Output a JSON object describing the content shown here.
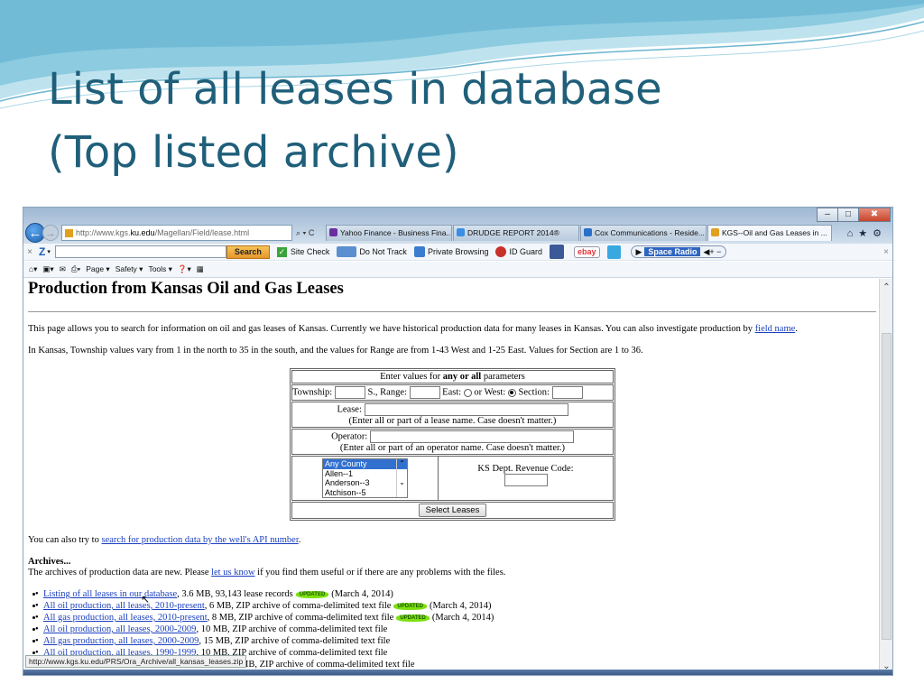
{
  "slide": {
    "title_line1": "List of all leases in database",
    "title_line2": "(Top listed archive)"
  },
  "browser": {
    "address": {
      "prefix": "http://www.kgs.",
      "host": "ku.edu",
      "path": "/Magellan/Field/lease.html"
    },
    "address_icons": "⌕ ▾ C",
    "tabs": [
      {
        "label": "Yahoo Finance - Business Fina...",
        "icon_color": "#6b2fa0"
      },
      {
        "label": "DRUDGE REPORT 2014®",
        "icon_color": "#3a8ee6"
      },
      {
        "label": "Cox Communications - Reside...",
        "icon_color": "#2a6fc9"
      },
      {
        "label": "KGS--Oil and Gas Leases in ...",
        "icon_color": "#e0a020",
        "active": true
      }
    ],
    "active_tab_close": "×",
    "right_icons": "⌂★⚙",
    "win_controls": [
      "–",
      "□",
      "✖"
    ],
    "toolbar1": {
      "logo": "Z",
      "search_button": "Search",
      "site_check": "Site Check",
      "do_not_track": "Do Not Track",
      "private_browsing": "Private Browsing",
      "id_guard": "ID Guard",
      "ebay": "ebay",
      "radio_label": "Space Radio",
      "volume": "◀+ −",
      "close": "×"
    },
    "toolbar2": {
      "page": "Page ▾",
      "safety": "Safety ▾",
      "tools": "Tools ▾",
      "help": "❓▾"
    },
    "status_url": "http://www.kgs.ku.edu/PRS/Ora_Archive/all_kansas_leases.zip"
  },
  "page": {
    "heading": "Production from Kansas Oil and Gas Leases",
    "intro": "This page allows you to search for information on oil and gas leases of Kansas. Currently we have historical production data for many leases in Kansas. You can also investigate production by ",
    "intro_link": "field name",
    "intro_end": ".",
    "township_info": "In Kansas, Township values vary from 1 in the north to 35 in the south, and the values for Range are from 1-43 West and 1-25 East. Values for Section are 1 to 36.",
    "form": {
      "header_pre": "Enter values for ",
      "header_bold": "any or all",
      "header_post": " parameters",
      "township_label": "Township:",
      "s_range_label": "S., Range:",
      "east_label": "East:",
      "west_label": "or West:",
      "section_label": "Section:",
      "lease_label": "Lease:",
      "lease_hint": "(Enter all or part of a lease name. Case doesn't matter.)",
      "operator_label": "Operator:",
      "operator_hint": "(Enter all or part of an operator name. Case doesn't matter.)",
      "county_options": [
        "Any County",
        "Allen--1",
        "Anderson--3",
        "Atchison--5"
      ],
      "ks_code_label": "KS Dept. Revenue Code:",
      "submit": "Select Leases"
    },
    "api_pre": "You can also try to ",
    "api_link": "search for production data by the well's API number",
    "api_post": ".",
    "archives_heading": "Archives...",
    "archives_pre": "The archives of production data are new. Please ",
    "archives_link": "let us know",
    "archives_post": " if you find them useful or if there are any problems with the files.",
    "badge_text": "UPDATED",
    "archive_items": [
      {
        "link": "Listing of all leases in our database",
        "text": ", 3.6 MB, 93,143 lease records",
        "date": "(March 4, 2014)"
      },
      {
        "link": "All oil production, all leases, 2010-present",
        "text": ", 6 MB, ZIP archive of comma-delimited text file",
        "date": "(March 4, 2014)"
      },
      {
        "link": "All gas production, all leases, 2010-present",
        "text": ", 8 MB, ZIP archive of comma-delimited text file",
        "date": "(March 4, 2014)"
      },
      {
        "link": "All oil production, all leases, 2000-2009",
        "text": ", 10 MB, ZIP archive of comma-delimited text file",
        "date": ""
      },
      {
        "link": "All gas production, all leases, 2000-2009",
        "text": ", 15 MB, ZIP archive of comma-delimited text file",
        "date": ""
      },
      {
        "link": "All oil production, all leases, 1990-1999",
        "text": ", 10 MB, ZIP archive of comma-delimited text file",
        "date": ""
      },
      {
        "link": "",
        "text": "MB, ZIP archive of comma-delimited text file",
        "date": ""
      }
    ]
  }
}
